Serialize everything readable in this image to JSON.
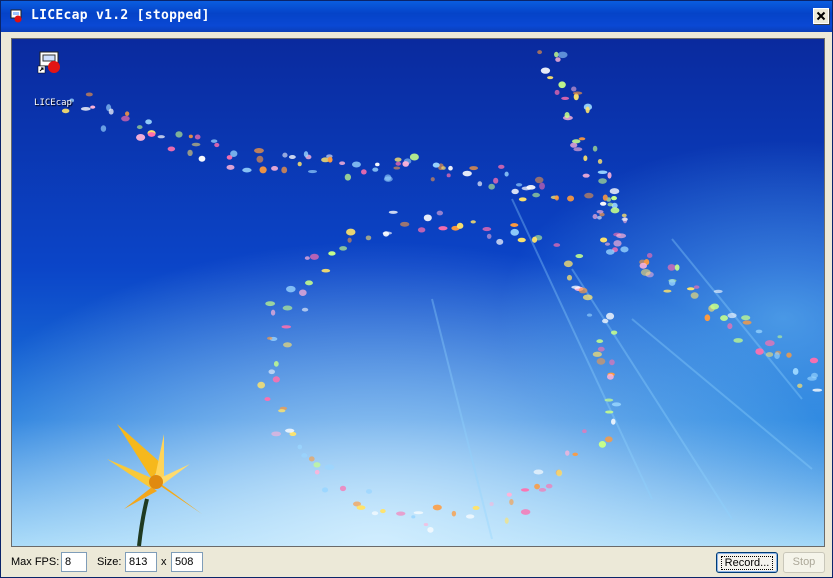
{
  "window": {
    "title": "LICEcap v1.2 [stopped]"
  },
  "icons": {
    "app": "licecap-app-icon",
    "close": "close-icon",
    "desktop_shortcut": "licecap-shortcut-icon"
  },
  "desktop": {
    "icon_label": "LICEcap"
  },
  "controls": {
    "max_fps_label": "Max FPS:",
    "max_fps_value": "8",
    "size_label": "Size:",
    "width_value": "813",
    "x_label": "x",
    "height_value": "508",
    "record_label": "Record...",
    "stop_label": "Stop"
  },
  "colors": {
    "titlebar": "#0a48d4",
    "frame": "#ece9d8",
    "sky_top": "#0a2fb3",
    "sky_bottom": "#8fd0f5"
  }
}
